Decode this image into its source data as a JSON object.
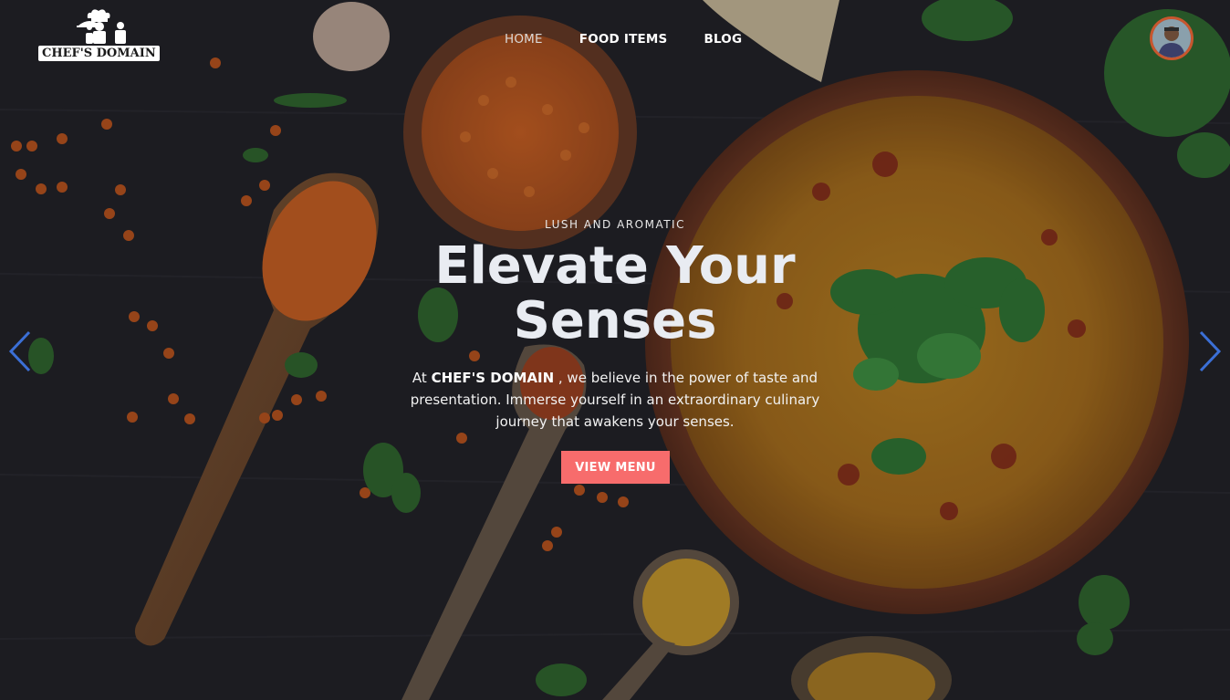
{
  "brand": {
    "name": "CHEF'S DOMAIN"
  },
  "nav": {
    "items": [
      {
        "label": "HOME",
        "active": true
      },
      {
        "label": "FOOD ITEMS",
        "active": false
      },
      {
        "label": "BLOG",
        "active": false
      }
    ]
  },
  "hero": {
    "eyebrow": "LUSH AND AROMATIC",
    "headline_line1": "Elevate Your",
    "headline_line2": "Senses",
    "desc_prefix": "At ",
    "desc_brand": "CHEF'S DOMAIN",
    "desc_suffix": " , we believe in the power of taste and presentation. Immerse yourself in an extraordinary culinary journey that awakens your senses.",
    "cta_label": "VIEW MENU"
  },
  "colors": {
    "accent": "#f76c6c",
    "arrow": "#3b6fd6",
    "background": "#1c1c20"
  },
  "icons": {
    "prev": "chevron-left-icon",
    "next": "chevron-right-icon"
  }
}
